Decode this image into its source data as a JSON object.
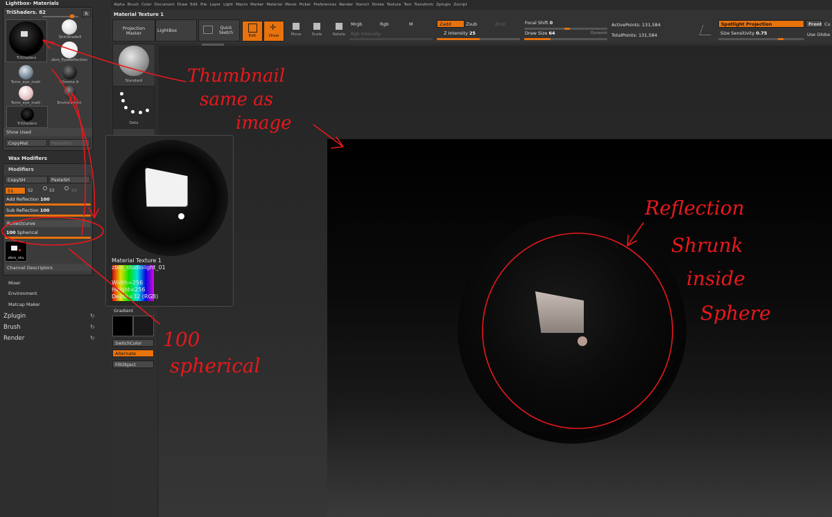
{
  "left_panel": {
    "lightbox_materials": "Lightbox› Materials",
    "trishaders_label": "TriShaders. 82",
    "r_button": "R",
    "materials": [
      {
        "label": "TriShaders",
        "icon": "trishader-sphere-icon"
      },
      {
        "label": "SkinShade4",
        "icon": "skinshade-sphere-icon"
      },
      {
        "label": "zbro_EyeReflection",
        "icon": "eyereflection-sphere-icon"
      },
      {
        "label": "Toms_eye_matt",
        "icon": "toms-eye-sphere-icon"
      },
      {
        "label": "Chrome A",
        "icon": "chrome-sphere-icon"
      },
      {
        "label": "Toms_eye_matt",
        "icon": "toms-eye-matt-sphere-icon"
      },
      {
        "label": "Environment",
        "icon": "environment-sphere-icon"
      },
      {
        "label": "TriShaders",
        "icon": "trishader-sphere-icon"
      }
    ],
    "show_used": "Show Used",
    "copy_mat": "CopyMat",
    "paste_mat": "PasteMat",
    "wax_modifiers": "Wax Modifiers",
    "modifiers": "Modifiers",
    "copy_sh": "CopySH",
    "paste_sh": "PasteSH",
    "s_tabs": [
      "S1",
      "S2",
      "S3",
      "S4"
    ],
    "add_reflection_label": "Add Reflection",
    "add_reflection_value": "100",
    "sub_reflection_label": "Sub Reflection",
    "sub_reflection_value": "100",
    "reflection_curve": "Reflectcurve",
    "spherical_value": "100",
    "spherical_label": "Spherical",
    "texture_thumb_label": "zbro_stu",
    "channel_descriptors": "Channel Descriptors",
    "mixer": "Mixer",
    "environment": "Environment",
    "matcap_maker": "Matcap Maker",
    "zplugin": "Zplugin",
    "brush": "Brush",
    "render": "Render"
  },
  "menu_bar": [
    "Alpha",
    "Brush",
    "Color",
    "Document",
    "Draw",
    "Edit",
    "File",
    "Layer",
    "Light",
    "Macro",
    "Marker",
    "Material",
    "Movie",
    "Picker",
    "Preferences",
    "Render",
    "Stencil",
    "Stroke",
    "Texture",
    "Tool",
    "Transform",
    "Zplugin",
    "Zscript"
  ],
  "toolbar": {
    "title": "Material Texture 1",
    "projection_master": "Projection Master",
    "lightbox": "LightBox",
    "quick_sketch": "Quick Sketch",
    "edit": "Edit",
    "draw": "Draw",
    "move": "Move",
    "scale": "Scale",
    "rotate": "Rotate",
    "mrgb": "Mrgb",
    "rgb": "Rgb",
    "m": "M",
    "rgb_intensity": "Rgb Intensity",
    "zadd": "Zadd",
    "zsub": "Zsub",
    "zcut": "Zcut",
    "z_intensity_label": "Z Intensity",
    "z_intensity_value": "25",
    "focal_shift_label": "Focal Shift",
    "focal_shift_value": "0",
    "draw_size_label": "Draw Size",
    "draw_size_value": "64",
    "dynamic": "Dynamic",
    "active_points_label": "ActivePoints:",
    "active_points_value": "131,584",
    "total_points_label": "TotalPoints:",
    "total_points_value": "131,584",
    "spotlight_projection": "Spotlight Projection",
    "front": "Front",
    "cu": "Cu",
    "size_sensitivity_label": "Size Sensitivity",
    "size_sensitivity_value": "0.75",
    "use_global": "Use Globa"
  },
  "palette": {
    "standard": "Standard",
    "dots": "Dots",
    "gradient": "Gradient",
    "switch_color": "SwitchColor",
    "alternate": "Alternate",
    "fill_object": "FillObject"
  },
  "popup": {
    "title": "Material Texture 1",
    "filename": "zbro_studiolight_01",
    "width": "Width=256",
    "height": "Height=256",
    "depth": "Depth=32 (RGB)"
  },
  "annotations": {
    "thumbnail_note": [
      "Thumbnail",
      "same as",
      "image"
    ],
    "reflection_note": [
      "Reflection",
      "Shrunk",
      "inside",
      "Sphere"
    ],
    "spherical_note": [
      "100",
      "spherical"
    ]
  },
  "colors": {
    "accent_orange": "#e8720c",
    "annotation_red": "#e8181c"
  }
}
